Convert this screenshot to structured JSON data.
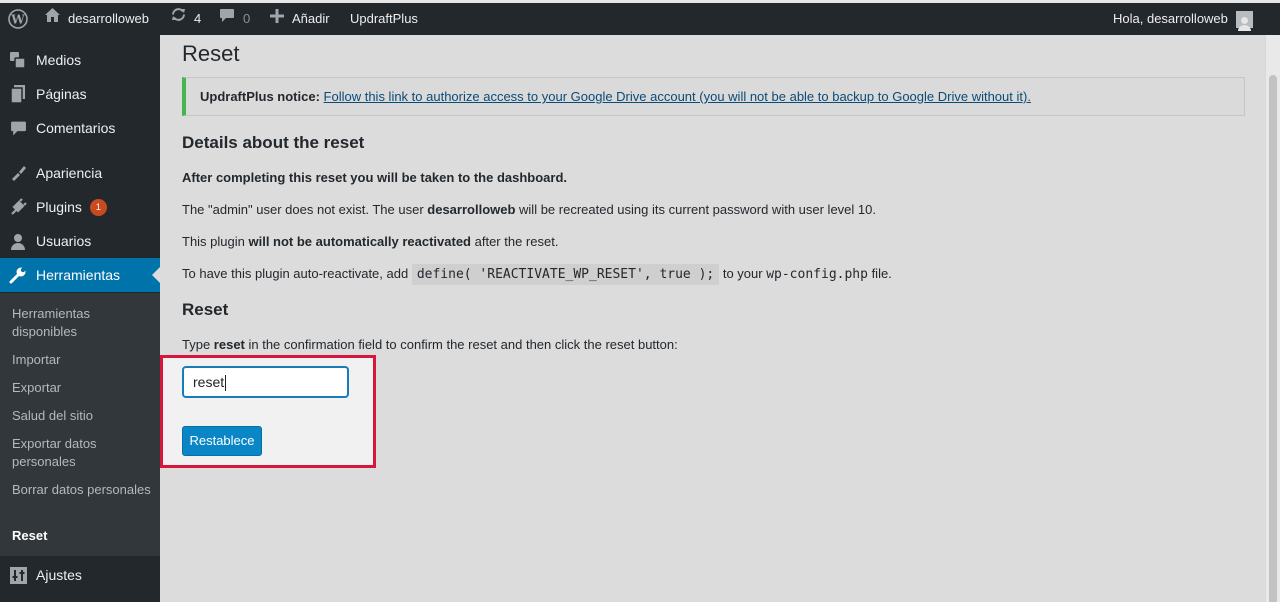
{
  "adminbar": {
    "site_name": "desarrolloweb",
    "updates_count": "4",
    "comments_count": "0",
    "add_new": "Añadir",
    "plugin_link": "UpdraftPlus",
    "greeting": "Hola, desarrolloweb"
  },
  "sidebar": {
    "items": [
      {
        "label": "Medios",
        "icon": "media-icon"
      },
      {
        "label": "Páginas",
        "icon": "pages-icon"
      },
      {
        "label": "Comentarios",
        "icon": "comments-icon"
      },
      {
        "label": "Apariencia",
        "icon": "appearance-icon"
      },
      {
        "label": "Plugins",
        "icon": "plugins-icon",
        "badge": "1"
      },
      {
        "label": "Usuarios",
        "icon": "users-icon"
      },
      {
        "label": "Herramientas",
        "icon": "tools-icon"
      },
      {
        "label": "Ajustes",
        "icon": "settings-icon"
      }
    ],
    "submenu": [
      "Herramientas disponibles",
      "Importar",
      "Exportar",
      "Salud del sitio",
      "Exportar datos personales",
      "Borrar datos personales",
      "Reset"
    ]
  },
  "main": {
    "title": "Reset",
    "notice": {
      "label": "UpdraftPlus notice:",
      "link": "Follow this link to authorize access to your Google Drive account (you will not be able to backup to Google Drive without it)."
    },
    "details_heading": "Details about the reset",
    "p1": "After completing this reset you will be taken to the dashboard.",
    "p2_a": "The \"admin\" user does not exist. The user ",
    "p2_b": "desarrolloweb",
    "p2_c": " will be recreated using its current password with user level 10.",
    "p3_a": "This plugin ",
    "p3_b": "will not be automatically reactivated",
    "p3_c": " after the reset.",
    "p4_a": "To have this plugin auto-reactivate, add ",
    "p4_code": "define( 'REACTIVATE_WP_RESET', true );",
    "p4_b": " to your ",
    "p4_file": "wp-config.php",
    "p4_c": " file.",
    "reset_heading": "Reset",
    "instr_a": "Type ",
    "instr_b": "reset",
    "instr_c": " in the confirmation field to confirm the reset and then click the reset button:",
    "input_value": "reset",
    "button_label": "Restablece"
  }
}
